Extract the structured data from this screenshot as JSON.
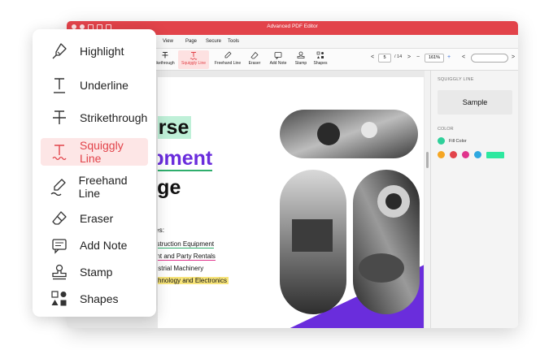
{
  "window": {
    "title": "Advanced PDF Editor"
  },
  "menubar": {
    "items": [
      "View",
      "Page",
      "Secure",
      "Tools"
    ]
  },
  "toolbar": {
    "tools": [
      {
        "label": "ikethrough",
        "icon": "strikethrough-icon"
      },
      {
        "label": "Squiggly Line",
        "icon": "squiggly-line-icon",
        "active": true
      },
      {
        "label": "Freehand Line",
        "icon": "freehand-line-icon"
      },
      {
        "label": "Eraser",
        "icon": "eraser-icon"
      },
      {
        "label": "Add Note",
        "icon": "add-note-icon"
      },
      {
        "label": "Stamp",
        "icon": "stamp-icon"
      },
      {
        "label": "Shapes",
        "icon": "shapes-icon"
      }
    ],
    "page_current": "5",
    "page_total": "/ 14",
    "zoom": "161%",
    "prev": "<",
    "next": ">",
    "minus": "−",
    "plus": "+"
  },
  "document": {
    "title_line1": "verse",
    "title_line2": "uipment",
    "title_line3": "ange",
    "categories_head": "ries:",
    "categories": [
      "nstruction Equipment",
      "ent and Party Rentals",
      "lustrial Machinery",
      "chnology and Electronics"
    ]
  },
  "right_panel": {
    "section": "SQUIGGLY LINE",
    "sample": "Sample",
    "color_section": "COLOR",
    "fill_label": "Fill Color",
    "fill_color": "#2fd09a",
    "swatches": [
      "#f5a623",
      "#e2434a",
      "#e0348c",
      "#2ea8e0"
    ],
    "bar_color": "#2ee89f"
  },
  "left_menu": {
    "items": [
      {
        "label": "Highlight",
        "icon": "highlight-icon"
      },
      {
        "label": "Underline",
        "icon": "underline-icon"
      },
      {
        "label": "Strikethrough",
        "icon": "strikethrough-icon"
      },
      {
        "label": "Squiggly Line",
        "icon": "squiggly-line-icon",
        "active": true
      },
      {
        "label": "Freehand Line",
        "icon": "freehand-line-icon"
      },
      {
        "label": "Eraser",
        "icon": "eraser-icon"
      },
      {
        "label": "Add Note",
        "icon": "add-note-icon"
      },
      {
        "label": "Stamp",
        "icon": "stamp-icon"
      },
      {
        "label": "Shapes",
        "icon": "shapes-icon"
      }
    ]
  },
  "colors": {
    "accent": "#e2434a",
    "purple": "#6a2ddc"
  }
}
